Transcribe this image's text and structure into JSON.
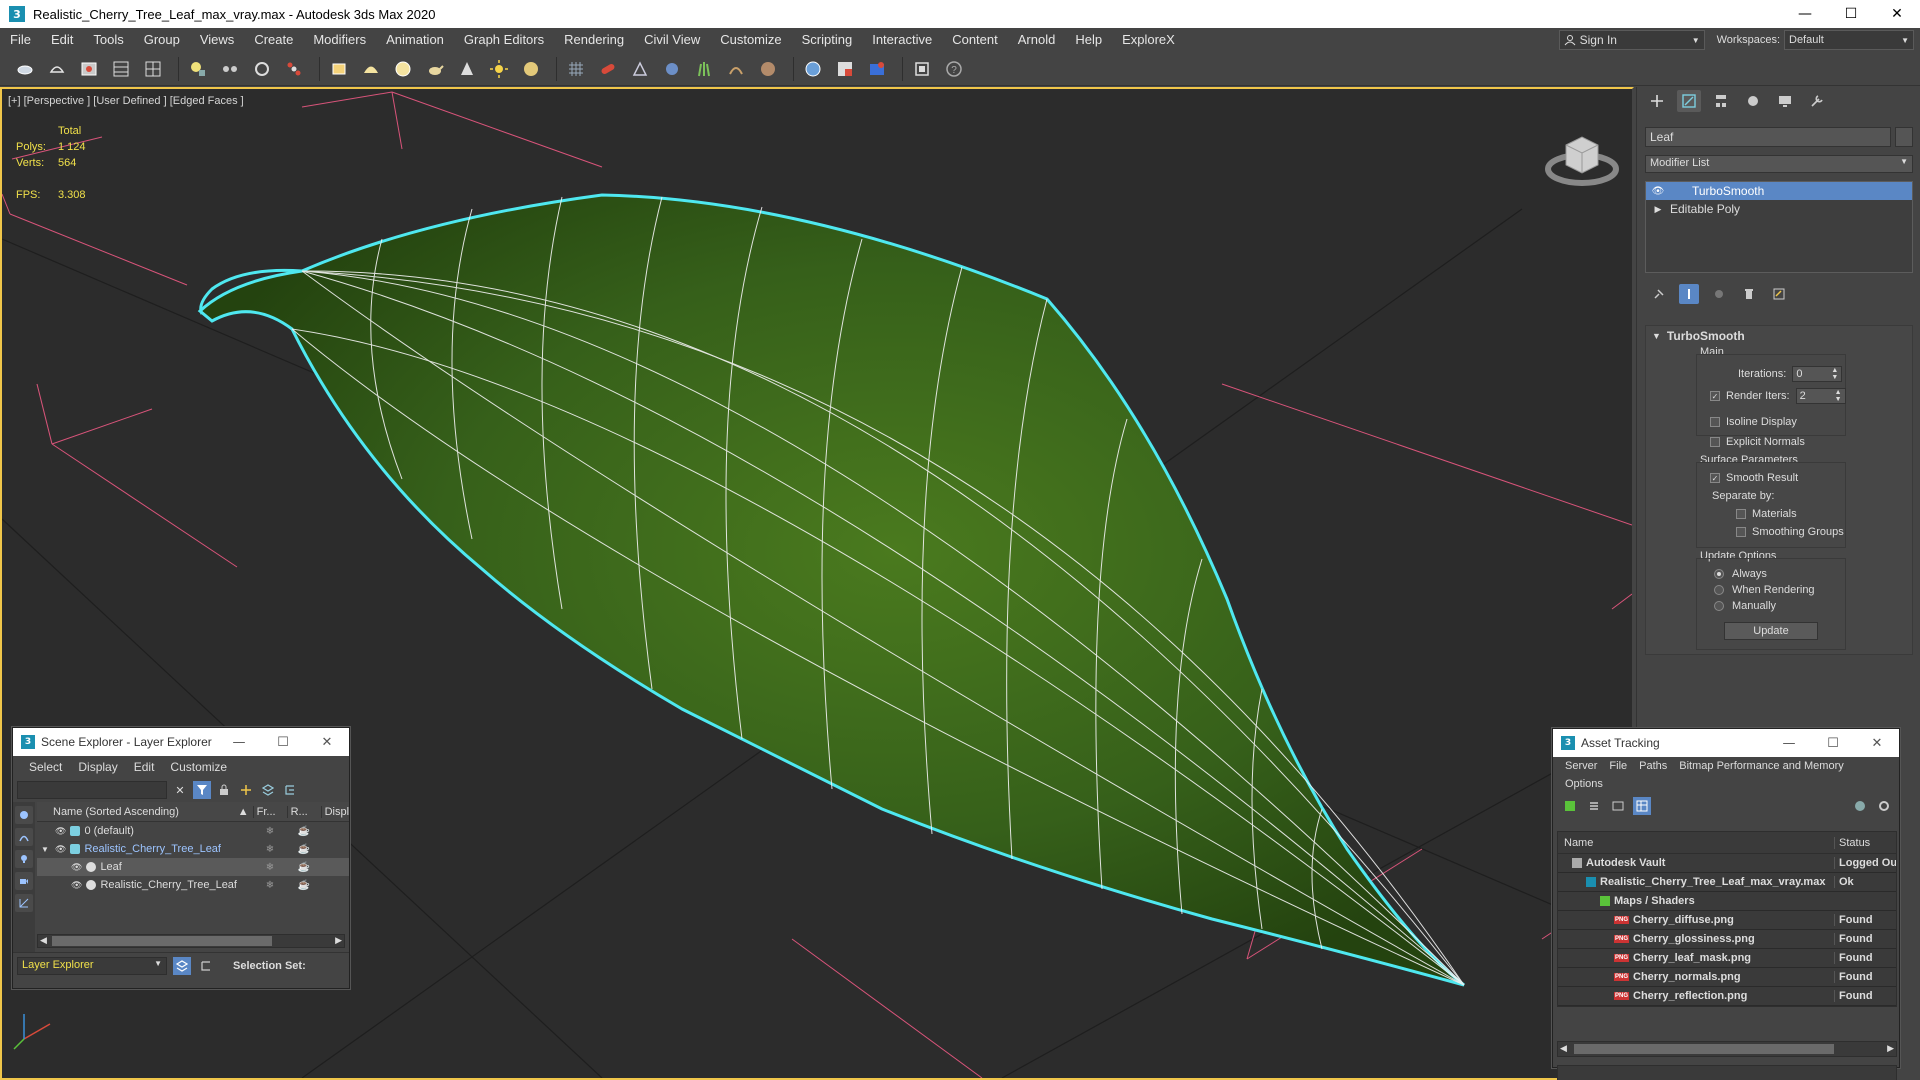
{
  "window": {
    "title": "Realistic_Cherry_Tree_Leaf_max_vray.max - Autodesk 3ds Max 2020",
    "app_icon_text": "3",
    "minimize": "—",
    "maximize": "☐",
    "close": "✕"
  },
  "menu": {
    "items": [
      "File",
      "Edit",
      "Tools",
      "Group",
      "Views",
      "Create",
      "Modifiers",
      "Animation",
      "Graph Editors",
      "Rendering",
      "Civil View",
      "Customize",
      "Scripting",
      "Interactive",
      "Content",
      "Arnold",
      "Help",
      "ExploreX"
    ],
    "sign_in": "Sign In",
    "workspaces_label": "Workspaces:",
    "workspace_value": "Default"
  },
  "viewport": {
    "label": "[+] [Perspective ] [User Defined ] [Edged Faces ]",
    "stats": {
      "total_label": "Total",
      "polys_label": "Polys:",
      "polys_value": "1 124",
      "verts_label": "Verts:",
      "verts_value": "564",
      "fps_label": "FPS:",
      "fps_value": "3.308"
    }
  },
  "command_panel": {
    "object_name": "Leaf",
    "modifier_list": "Modifier List",
    "stack": [
      {
        "label": "TurboSmooth",
        "selected": true
      },
      {
        "label": "Editable Poly",
        "selected": false
      }
    ],
    "rollout": {
      "title": "TurboSmooth",
      "main_label": "Main",
      "iterations_label": "Iterations:",
      "iterations_value": "0",
      "render_iters_label": "Render Iters:",
      "render_iters_value": "2",
      "render_iters_checked": true,
      "isoline_label": "Isoline Display",
      "explicit_normals_label": "Explicit Normals",
      "surface_label": "Surface Parameters",
      "smooth_result_label": "Smooth Result",
      "separate_by_label": "Separate by:",
      "materials_label": "Materials",
      "smoothing_groups_label": "Smoothing Groups",
      "update_options_label": "Update Options",
      "always_label": "Always",
      "when_rendering_label": "When Rendering",
      "manually_label": "Manually",
      "update_button": "Update"
    }
  },
  "scene_explorer": {
    "title": "Scene Explorer - Layer Explorer",
    "menu": [
      "Select",
      "Display",
      "Edit",
      "Customize"
    ],
    "columns": {
      "name": "Name (Sorted Ascending)",
      "sort_arrow": "▲",
      "frozen": "Fr...",
      "render": "R...",
      "display": "Displ"
    },
    "rows": [
      {
        "name": "0 (default)",
        "indent": 0,
        "expand": "",
        "highlight": false,
        "selected": false
      },
      {
        "name": "Realistic_Cherry_Tree_Leaf",
        "indent": 0,
        "expand": "▼",
        "highlight": true,
        "selected": false
      },
      {
        "name": "Leaf",
        "indent": 1,
        "expand": "",
        "highlight": false,
        "selected": true
      },
      {
        "name": "Realistic_Cherry_Tree_Leaf",
        "indent": 1,
        "expand": "",
        "highlight": false,
        "selected": false
      }
    ],
    "footer": {
      "explorer_select": "Layer Explorer",
      "selection_set_label": "Selection Set:"
    }
  },
  "asset_tracking": {
    "title": "Asset Tracking",
    "menu": [
      "Server",
      "File",
      "Paths",
      "Bitmap Performance and Memory",
      "Options"
    ],
    "columns": {
      "name": "Name",
      "status": "Status"
    },
    "rows": [
      {
        "name": "Autodesk Vault",
        "status": "Logged Out",
        "indent": 1,
        "icon": "vault"
      },
      {
        "name": "Realistic_Cherry_Tree_Leaf_max_vray.max",
        "status": "Ok",
        "indent": 2,
        "icon": "max"
      },
      {
        "name": "Maps / Shaders",
        "status": "",
        "indent": 3,
        "icon": "maps"
      },
      {
        "name": "Cherry_diffuse.png",
        "status": "Found",
        "indent": 4,
        "icon": "png"
      },
      {
        "name": "Cherry_glossiness.png",
        "status": "Found",
        "indent": 4,
        "icon": "png"
      },
      {
        "name": "Cherry_leaf_mask.png",
        "status": "Found",
        "indent": 4,
        "icon": "png"
      },
      {
        "name": "Cherry_normals.png",
        "status": "Found",
        "indent": 4,
        "icon": "png"
      },
      {
        "name": "Cherry_reflection.png",
        "status": "Found",
        "indent": 4,
        "icon": "png"
      }
    ],
    "png_badge": "PNG"
  },
  "colors": {
    "selection_blue": "#5a87c5",
    "leaf_green": "#3f6a1a",
    "leaf_outline": "#4fe8f0",
    "stats_yellow": "#f0e04a",
    "grid_pink": "#d8547a"
  }
}
